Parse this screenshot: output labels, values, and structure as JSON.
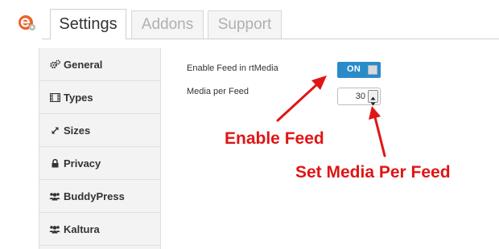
{
  "tabs": [
    {
      "label": "Settings",
      "active": true
    },
    {
      "label": "Addons",
      "active": false
    },
    {
      "label": "Support",
      "active": false
    }
  ],
  "sidebar": {
    "items": [
      {
        "label": "General",
        "icon": "cogs-icon"
      },
      {
        "label": "Types",
        "icon": "film-icon"
      },
      {
        "label": "Sizes",
        "icon": "resize-icon"
      },
      {
        "label": "Privacy",
        "icon": "lock-icon"
      },
      {
        "label": "BuddyPress",
        "icon": "group-icon"
      },
      {
        "label": "Kaltura",
        "icon": "group-icon"
      }
    ]
  },
  "settings": {
    "enable_feed_label": "Enable Feed in rtMedia",
    "enable_feed_toggle": "ON",
    "media_per_feed_label": "Media per Feed",
    "media_per_feed_value": "30"
  },
  "annotations": {
    "enable_feed": "Enable Feed",
    "set_media_per_feed": "Set Media Per Feed"
  },
  "colors": {
    "toggle_on": "#2a8bc9",
    "annotation_red": "#e01515",
    "logo_orange": "#e8652b"
  }
}
